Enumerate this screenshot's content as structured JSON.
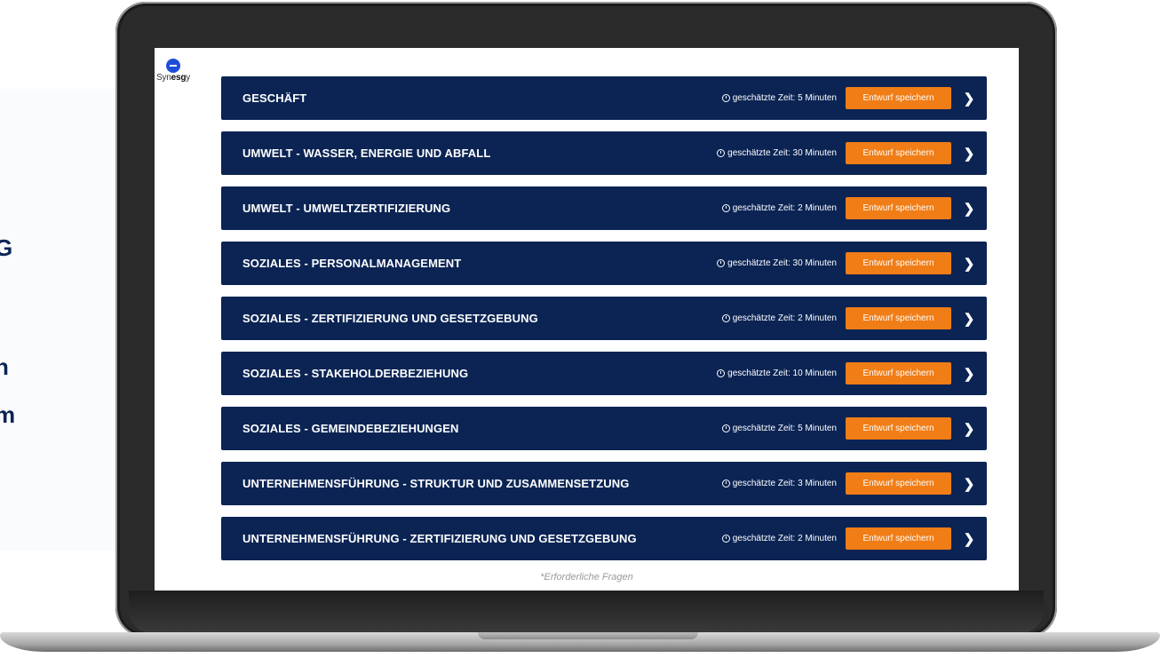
{
  "backdrop": {
    "letters": [
      "G",
      "n",
      "m"
    ]
  },
  "logo": {
    "prefix": "Syn",
    "bold": "esg",
    "suffix": "y"
  },
  "sections": [
    {
      "title": "GESCHÄFT",
      "time": "geschätzte Zeit: 5 Minuten",
      "button": "Entwurf speichern"
    },
    {
      "title": "UMWELT - WASSER, ENERGIE UND ABFALL",
      "time": "geschätzte Zeit: 30 Minuten",
      "button": "Entwurf speichern"
    },
    {
      "title": "UMWELT - UMWELTZERTIFIZIERUNG",
      "time": "geschätzte Zeit: 2 Minuten",
      "button": "Entwurf speichern"
    },
    {
      "title": "SOZIALES - PERSONALMANAGEMENT",
      "time": "geschätzte Zeit: 30 Minuten",
      "button": "Entwurf speichern"
    },
    {
      "title": "SOZIALES - ZERTIFIZIERUNG UND GESETZGEBUNG",
      "time": "geschätzte Zeit: 2 Minuten",
      "button": "Entwurf speichern"
    },
    {
      "title": "SOZIALES - STAKEHOLDERBEZIEHUNG",
      "time": "geschätzte Zeit: 10 Minuten",
      "button": "Entwurf speichern"
    },
    {
      "title": "SOZIALES - GEMEINDEBEZIEHUNGEN",
      "time": "geschätzte Zeit: 5 Minuten",
      "button": "Entwurf speichern"
    },
    {
      "title": "UNTERNEHMENSFÜHRUNG - STRUKTUR UND ZUSAMMENSETZUNG",
      "time": "geschätzte Zeit: 3 Minuten",
      "button": "Entwurf speichern"
    },
    {
      "title": "UNTERNEHMENSFÜHRUNG - ZERTIFIZIERUNG UND GESETZGEBUNG",
      "time": "geschätzte Zeit: 2 Minuten",
      "button": "Entwurf speichern"
    }
  ],
  "footnote": "*Erforderliche Fragen",
  "colors": {
    "row_bg": "#0b2454",
    "button_bg": "#f07d16",
    "logo_blue": "#1d4ed8"
  }
}
